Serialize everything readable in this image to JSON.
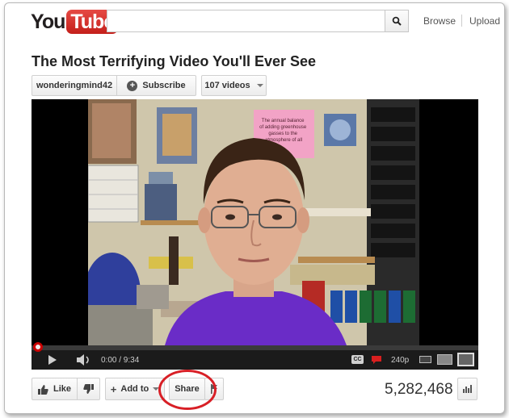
{
  "header": {
    "logo_you": "You",
    "logo_tube": "Tube",
    "search": {
      "value": "",
      "placeholder": ""
    },
    "links": {
      "browse": "Browse",
      "upload": "Upload"
    }
  },
  "video": {
    "title": "The Most Terrifying Video You'll Ever See",
    "channel": "wonderingmind42",
    "subscribe_label": "Subscribe",
    "videos_count_label": "107 videos",
    "poster_text": "The annual balance of adding greenhouse gasses to the atmosphere of all",
    "player": {
      "time_label": "0:00 / 9:34",
      "quality": "240p",
      "progress": 0,
      "cc_label": "CC"
    },
    "actions": {
      "like_label": "Like",
      "add_to_label": "Add to",
      "share_label": "Share"
    },
    "view_count": "5,282,468"
  },
  "colors": {
    "logo_red": "#c4201b",
    "annotation_red": "#d81f26",
    "player_bg": "#000000",
    "scrubber_red": "#cc0000"
  }
}
